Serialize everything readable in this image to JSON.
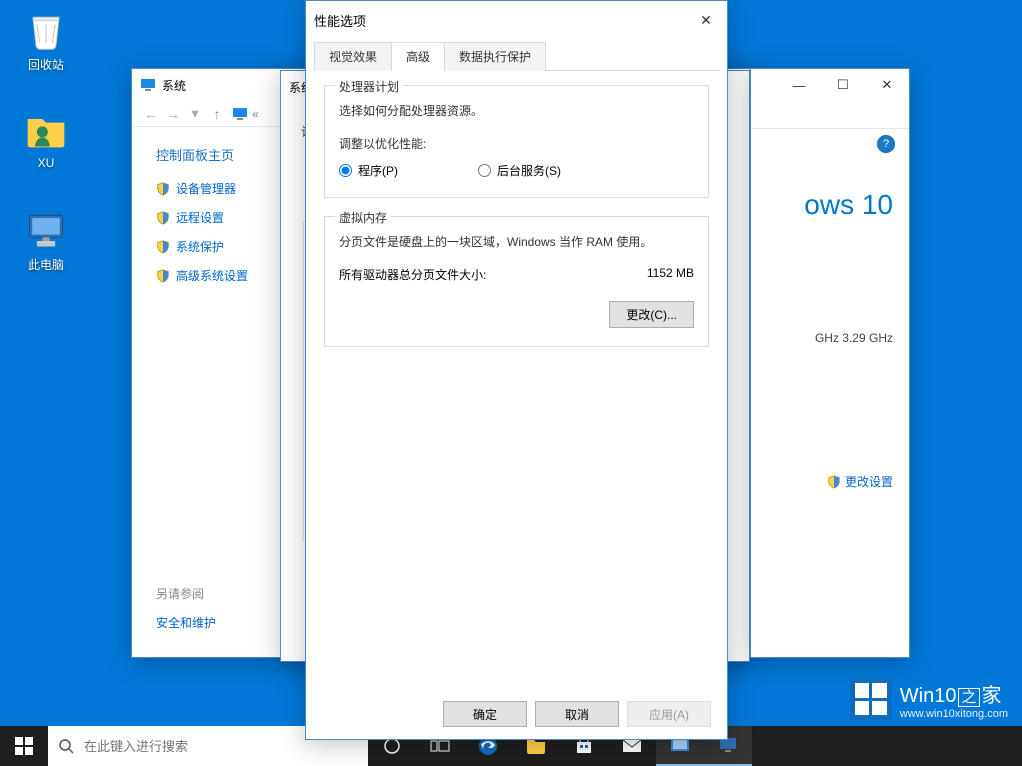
{
  "desktop": {
    "icons": [
      {
        "label": "回收站"
      },
      {
        "label": "XU"
      },
      {
        "label": "此电脑"
      }
    ]
  },
  "system_window": {
    "title": "系统",
    "sidebar_heading": "控制面板主页",
    "links": [
      "设备管理器",
      "远程设置",
      "系统保护",
      "高级系统设置"
    ],
    "see_also": "另请参阅",
    "security": "安全和维护"
  },
  "ghost_window": {
    "title_prefix": "系统",
    "body_label": "计算"
  },
  "info_panel": {
    "brand": "ows 10",
    "ghz": "GHz   3.29 GHz",
    "change_settings": "更改设置",
    "help": "?"
  },
  "perf_dialog": {
    "title": "性能选项",
    "tabs": {
      "visual": "视觉效果",
      "advanced": "高级",
      "dep": "数据执行保护"
    },
    "processor": {
      "legend": "处理器计划",
      "desc": "选择如何分配处理器资源。",
      "adjust_label": "调整以优化性能:",
      "programs": "程序(P)",
      "background": "后台服务(S)"
    },
    "vm": {
      "legend": "虚拟内存",
      "desc": "分页文件是硬盘上的一块区域，Windows 当作 RAM 使用。",
      "total_label": "所有驱动器总分页文件大小:",
      "total_value": "1152 MB",
      "change_btn": "更改(C)..."
    },
    "buttons": {
      "ok": "确定",
      "cancel": "取消",
      "apply": "应用(A)"
    }
  },
  "taskbar": {
    "search_placeholder": "在此键入进行搜索"
  },
  "watermark": {
    "brand": "Win10",
    "suffix": "家",
    "url": "www.win10xitong.com"
  }
}
